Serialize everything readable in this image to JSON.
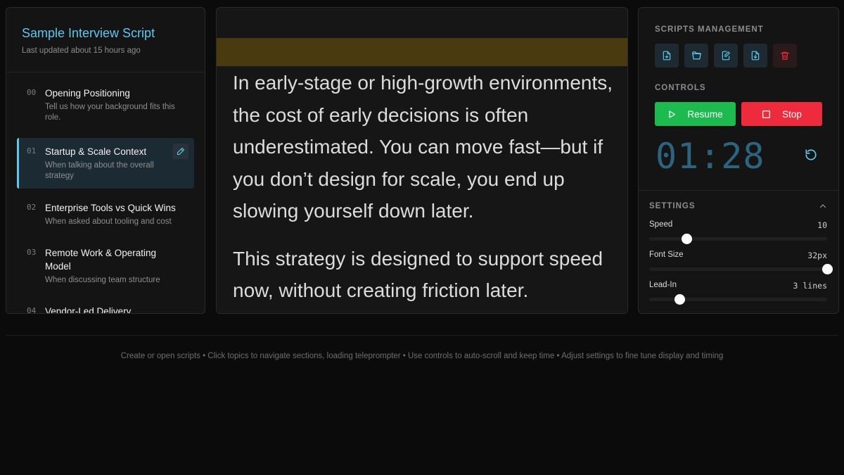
{
  "script": {
    "title": "Sample Interview Script",
    "updated": "Last updated about 15 hours ago"
  },
  "topics": [
    {
      "num": "00",
      "title": "Opening Positioning",
      "sub": "Tell us how your background fits this role."
    },
    {
      "num": "01",
      "title": "Startup & Scale Context",
      "sub": "When talking about the overall strategy",
      "active": true
    },
    {
      "num": "02",
      "title": "Enterprise Tools vs Quick Wins",
      "sub": "When asked about tooling and cost"
    },
    {
      "num": "03",
      "title": "Remote Work & Operating Model",
      "sub": "When discussing team structure"
    },
    {
      "num": "04",
      "title": "Vendor-Led Delivery",
      "sub": ""
    }
  ],
  "prompter": {
    "para1": "In early-stage or high-growth environments, the cost of early decisions is often underestimated. You can move fast—but if you don’t design for scale, you end up slowing yourself down later.",
    "para2": "This strategy is designed to support speed now, without creating friction later."
  },
  "management": {
    "label": "SCRIPTS MANAGEMENT",
    "icons": [
      "new-file-icon",
      "open-folder-icon",
      "edit-icon",
      "download-icon",
      "trash-icon"
    ]
  },
  "controls": {
    "label": "CONTROLS",
    "resume_label": "Resume",
    "stop_label": "Stop",
    "timer": "01:28"
  },
  "settings": {
    "label": "SETTINGS",
    "speed": {
      "name": "Speed",
      "value": "10",
      "fraction": 0.21
    },
    "font_size": {
      "name": "Font Size",
      "value": "32px",
      "fraction": 1.0
    },
    "lead_in": {
      "name": "Lead-In",
      "value": "3 lines",
      "fraction": 0.17
    }
  },
  "footer": "Create or open scripts • Click topics to navigate sections, loading teleprompter • Use controls to auto-scroll and keep time • Adjust settings to fine tune display and timing",
  "colors": {
    "accent": "#5ec8ef",
    "resume": "#1dbb4f",
    "stop": "#ee2b3c",
    "highlight": "#4a3a10",
    "timer": "#2c6480"
  }
}
